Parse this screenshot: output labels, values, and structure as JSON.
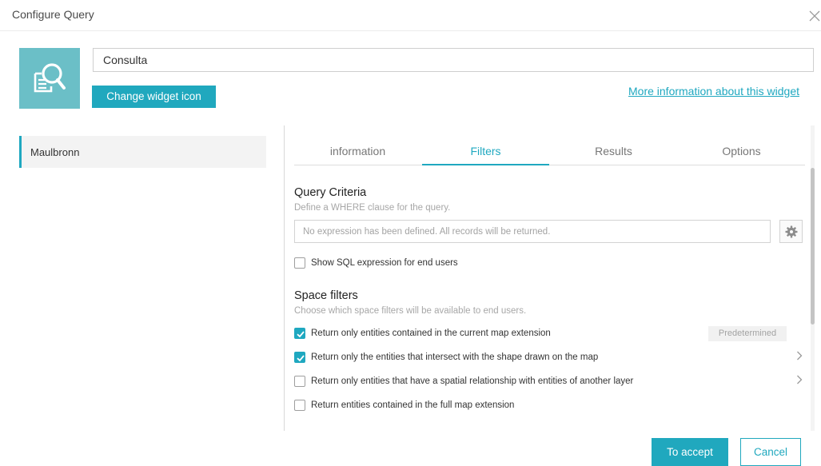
{
  "dialog": {
    "title": "Configure Query"
  },
  "widget": {
    "name_value": "Consulta",
    "change_icon_label": "Change widget icon",
    "more_info_link": "More information about this widget",
    "icon": "search-document-icon"
  },
  "layers": [
    {
      "label": "Maulbronn",
      "selected": true
    }
  ],
  "tabs": [
    {
      "label": "information",
      "active": false
    },
    {
      "label": "Filters",
      "active": true
    },
    {
      "label": "Results",
      "active": false
    },
    {
      "label": "Options",
      "active": false
    }
  ],
  "query_criteria": {
    "title": "Query Criteria",
    "hint": "Define a WHERE clause for the query.",
    "expression_placeholder": "No expression has been defined. All records will be returned.",
    "expression_value": "",
    "show_sql_label": "Show SQL expression for end users",
    "show_sql_checked": false
  },
  "space_filters": {
    "title": "Space filters",
    "hint": "Choose which space filters will be available to end users.",
    "options": [
      {
        "label": "Return only entities contained in the current map extension",
        "checked": true,
        "badge": "Predetermined"
      },
      {
        "label": "Return only the entities that intersect with the shape drawn on the map",
        "checked": true,
        "has_chevron": true
      },
      {
        "label": "Return only entities that have a spatial relationship with entities of another layer",
        "checked": false,
        "has_chevron": true
      },
      {
        "label": "Return entities contained in the full map extension",
        "checked": false
      }
    ]
  },
  "footer": {
    "accept_label": "To accept",
    "cancel_label": "Cancel"
  },
  "colors": {
    "accent": "#1fa8c0",
    "icon_bg": "#6bbfc7"
  }
}
